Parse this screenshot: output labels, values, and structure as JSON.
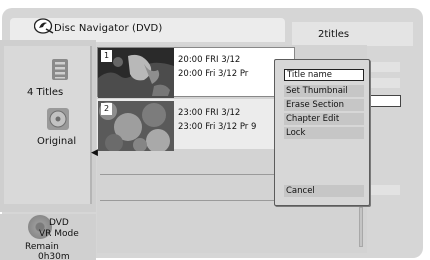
{
  "header": {
    "title": "Disc Navigator (DVD)",
    "titles_count": "2titles"
  },
  "left_panel": {
    "titles_label": "4 Titles",
    "original_label": "Original"
  },
  "disc_status": {
    "disc_type": "DVD",
    "mode": "VR Mode",
    "remain_label": "Remain",
    "remain_time": "0h30m"
  },
  "titles": [
    {
      "number": "1",
      "line1": "20:00  FRI  3/12",
      "line2": "20:00    Fri 3/12   Pr",
      "selected": true
    },
    {
      "number": "2",
      "line1": "23:00  FRI  3/12",
      "line2": "23:00    Fri 3/12   Pr 9",
      "selected": false
    }
  ],
  "popup_menu": {
    "items": [
      {
        "label": "Title name",
        "selected": true
      },
      {
        "label": "Set Thumbnail",
        "selected": false
      },
      {
        "label": "Erase Section",
        "selected": false
      },
      {
        "label": "Chapter Edit",
        "selected": false
      },
      {
        "label": "Lock",
        "selected": false
      }
    ],
    "cancel": "Cancel"
  },
  "icons": {
    "nav_icon": "disc-navigator-icon",
    "list_icon": "title-list-icon",
    "disc_icon": "original-disc-icon",
    "arrow_icon": "left-arrow-icon"
  }
}
